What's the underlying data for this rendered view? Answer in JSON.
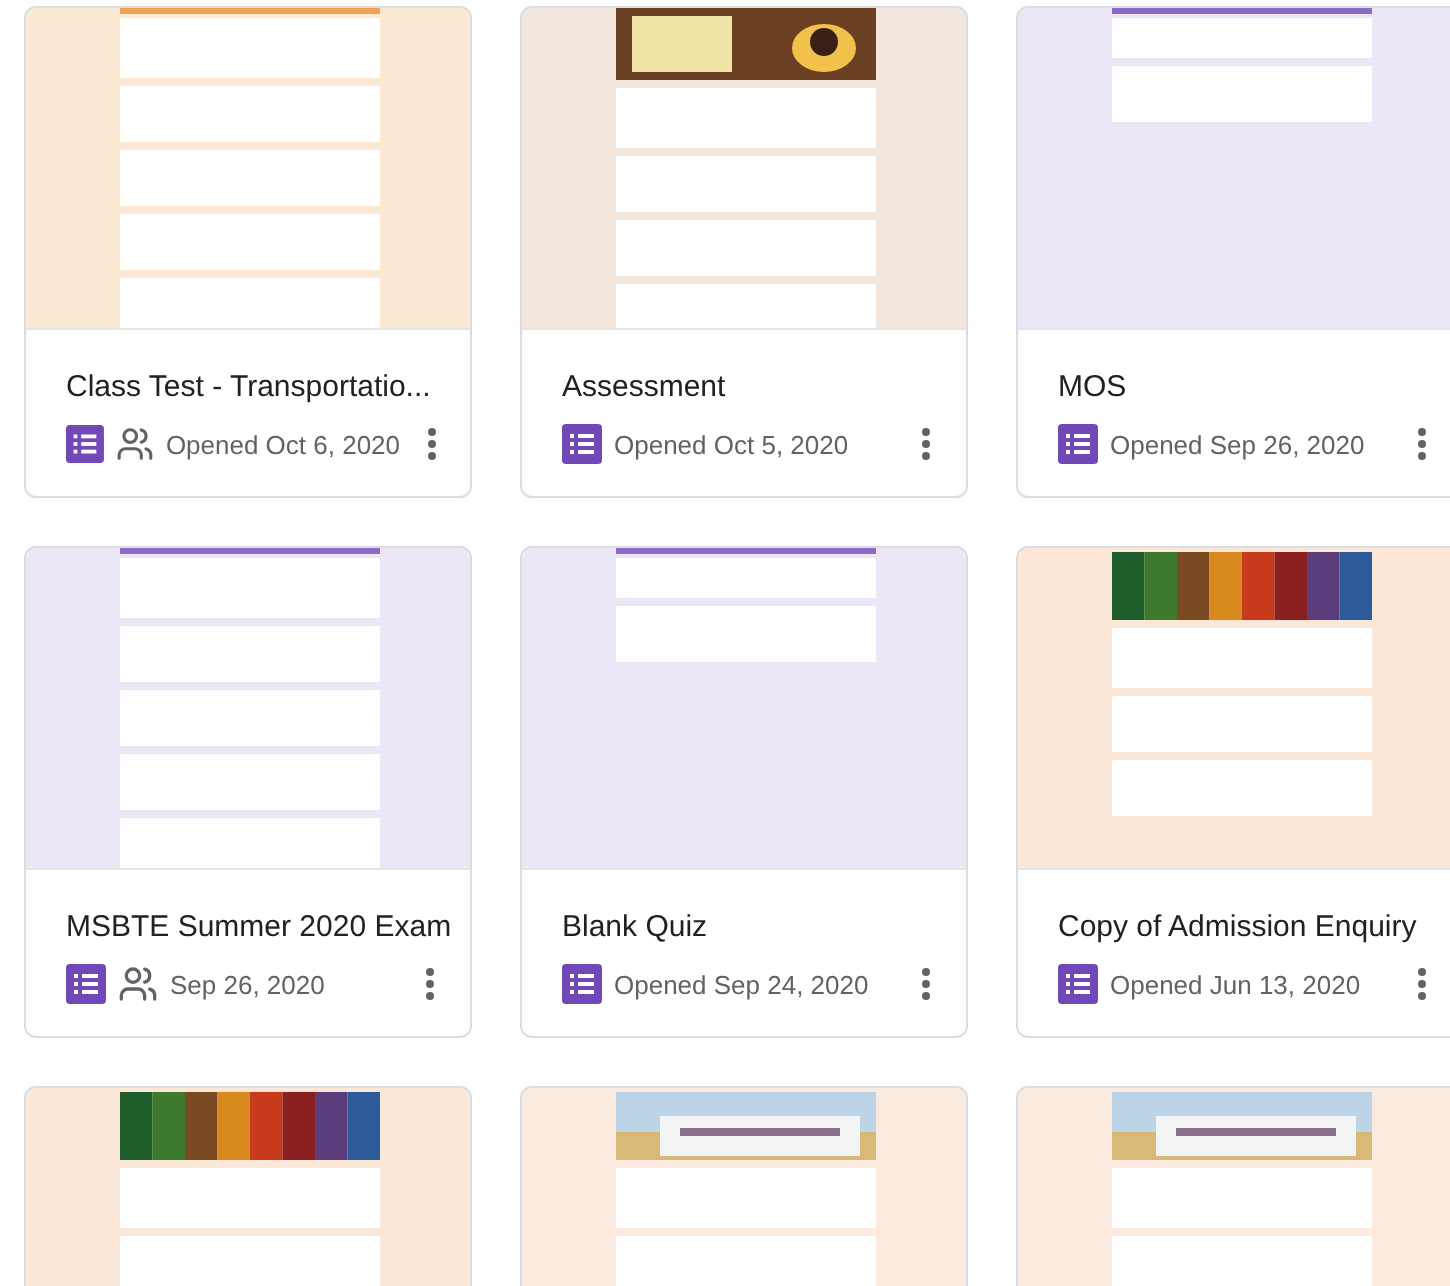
{
  "cards": [
    {
      "preview": {
        "kind": "picture"
      },
      "title": "Class Test - Transportatio...",
      "shared": true,
      "date": "Opened Oct 6, 2020"
    },
    {
      "preview": {
        "kind": "picture"
      },
      "title": "Assessment",
      "shared": false,
      "date": "Opened Oct 5, 2020"
    },
    {
      "preview": {
        "kind": "picture"
      },
      "title": "MOS",
      "shared": false,
      "date": "Opened Sep 26, 2020"
    },
    {
      "preview": {
        "kind": "picture"
      },
      "title": "MSBTE Summer 2020 Exam",
      "shared": true,
      "date": "Sep 26, 2020"
    },
    {
      "preview": {
        "kind": "picture"
      },
      "title": "Blank Quiz",
      "shared": false,
      "date": "Opened Sep 24, 2020"
    },
    {
      "preview": {
        "kind": "picture"
      },
      "title": "Copy of Admission Enquiry",
      "shared": false,
      "date": "Opened Jun 13, 2020"
    },
    {
      "preview": {
        "kind": "picture"
      }
    },
    {
      "preview": {
        "kind": "picture"
      }
    },
    {
      "preview": {
        "kind": "picture"
      }
    }
  ]
}
